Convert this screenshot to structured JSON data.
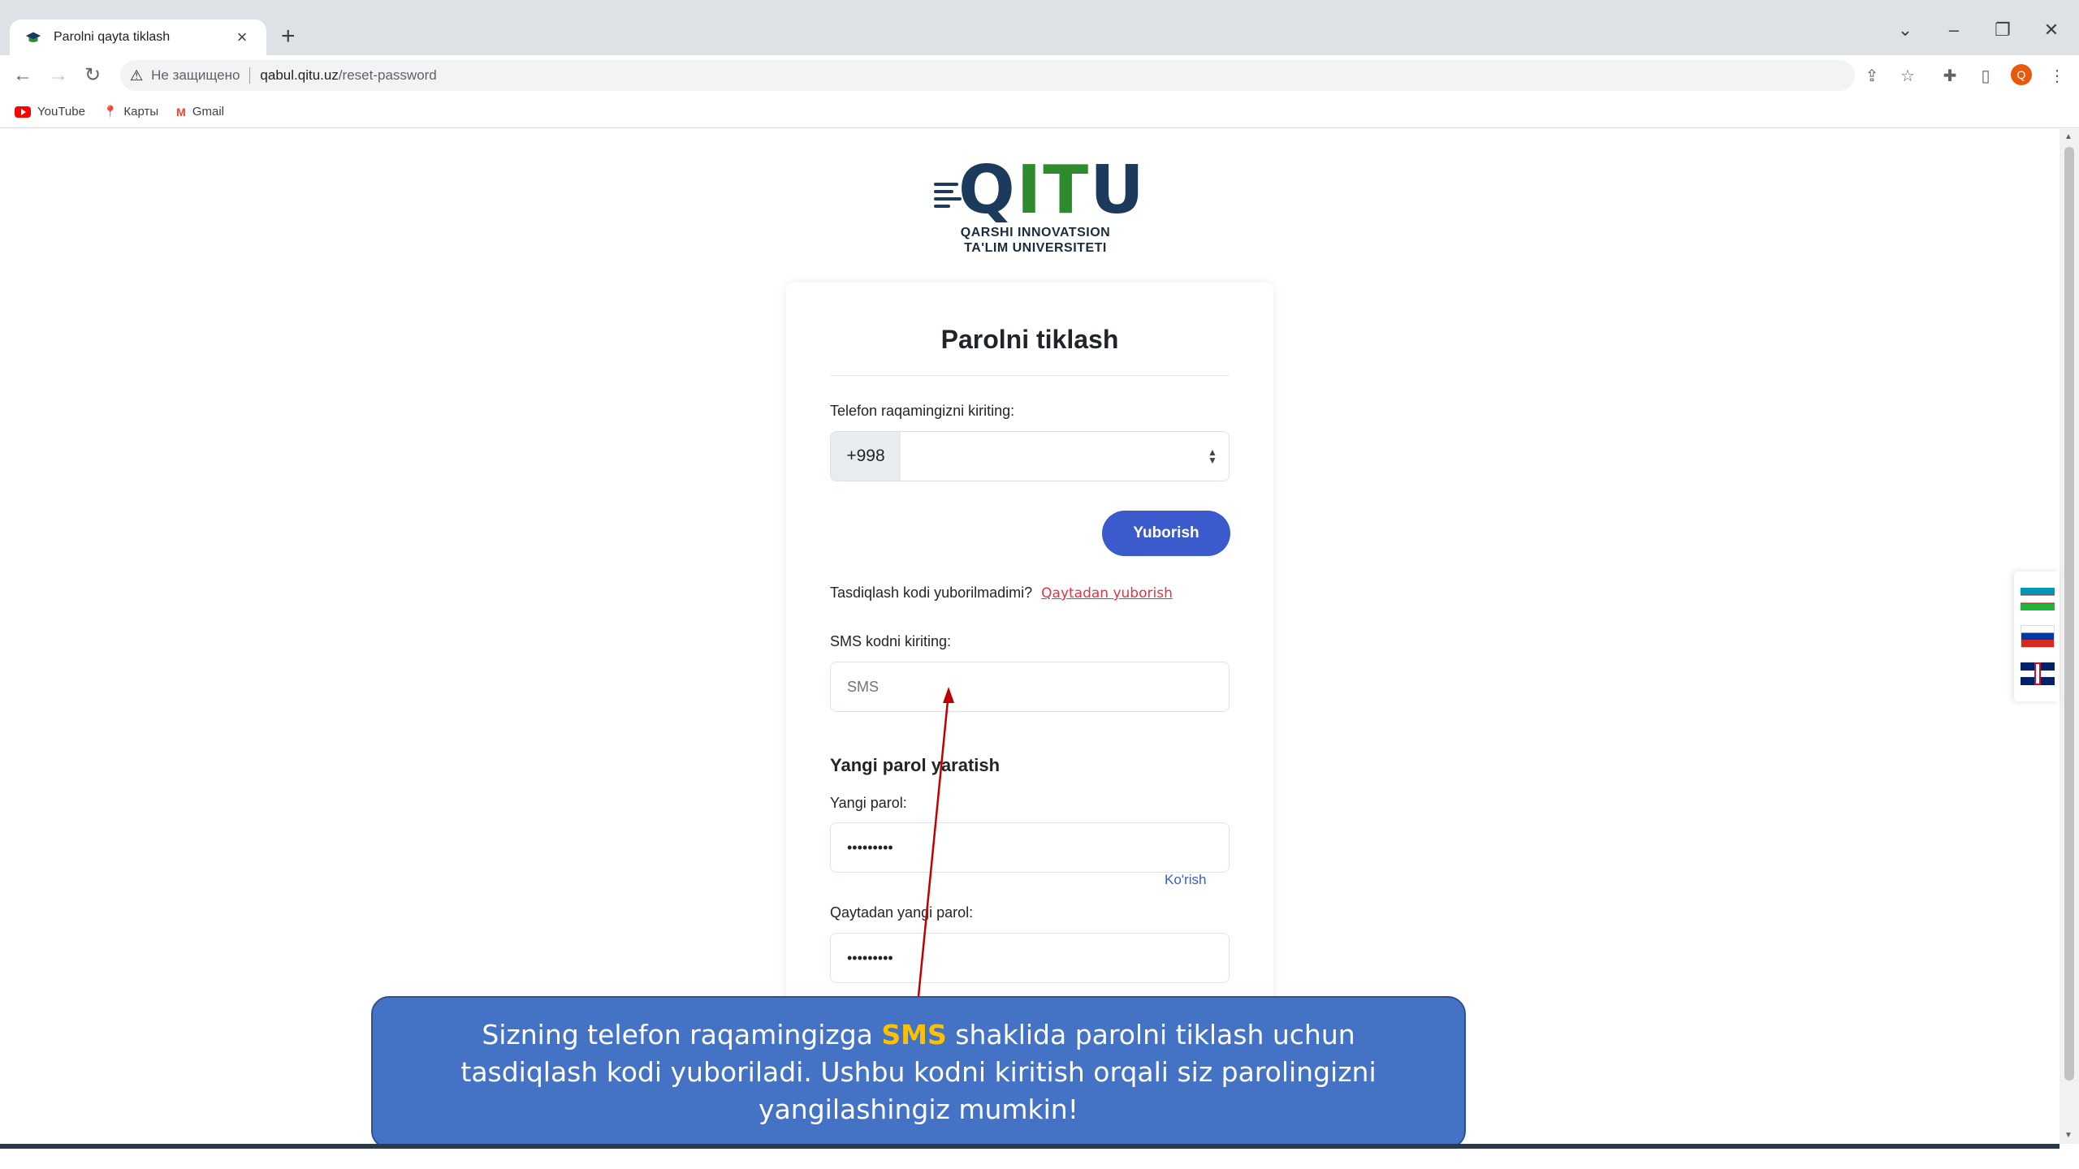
{
  "browser": {
    "tab_title": "Parolni qayta tiklash",
    "tab_close": "×",
    "new_tab": "+",
    "security_label": "Не защищено",
    "url_host": "qabul.qitu.uz",
    "url_path": "/reset-password",
    "profile_initial": "Q",
    "bookmarks": [
      "YouTube",
      "Карты",
      "Gmail"
    ]
  },
  "logo": {
    "letters": "QITU",
    "line1": "QARSHI INNOVATSION",
    "line2": "TA'LIM UNIVERSITETI"
  },
  "form": {
    "title": "Parolni tiklash",
    "phone_label": "Telefon raqamingizni kiriting:",
    "phone_prefix": "+998",
    "phone_value": "",
    "send_button": "Yuborish",
    "resend_question": "Tasdiqlash kodi yuborilmadimi?",
    "resend_link": "Qaytadan yuborish",
    "sms_label": "SMS kodni kiriting:",
    "sms_placeholder": "SMS",
    "new_password_section": "Yangi parol yaratish",
    "new_password_label": "Yangi parol:",
    "new_password_value": "•••••••••",
    "show_link": "Ko'rish",
    "repeat_password_label": "Qaytadan yangi parol:",
    "repeat_password_value": "•••••••••"
  },
  "languages": [
    "uz",
    "ru",
    "en"
  ],
  "callout": {
    "text_before": "Sizning telefon raqamingizga ",
    "highlight": "SMS",
    "text_after": " shaklida parolni tiklash uchun tasdiqlash kodi yuboriladi. Ushbu kodni kiritish orqali siz parolingizni yangilashingiz mumkin!",
    "highlight_color": "#ffc000",
    "background_color": "#4472c4"
  },
  "colors": {
    "primary_button": "#3b5bcc",
    "link_red": "#dc3545",
    "arrow": "#c00000"
  }
}
